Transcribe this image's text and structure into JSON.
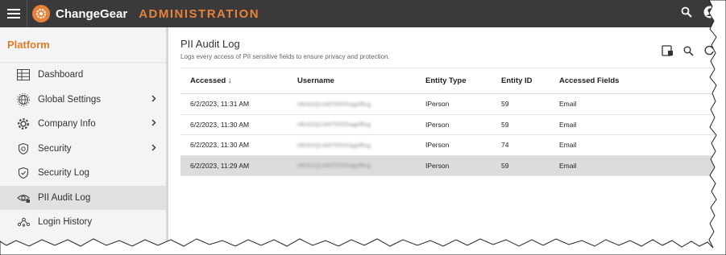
{
  "header": {
    "app_name": "ChangeGear",
    "section": "ADMINISTRATION",
    "colors": {
      "bar": "#3a3a3a",
      "accent": "#e8823a"
    },
    "icons": [
      "menu-icon",
      "gear-logo-icon",
      "search-icon",
      "user-account-icon"
    ]
  },
  "sidebar": {
    "title": "Platform",
    "items": [
      {
        "label": "Dashboard",
        "icon": "table-grid-icon",
        "chevron": false,
        "active": false
      },
      {
        "label": "Global Settings",
        "icon": "globe-icon",
        "chevron": true,
        "active": false
      },
      {
        "label": "Company Info",
        "icon": "gear-icon",
        "chevron": true,
        "active": false
      },
      {
        "label": "Security",
        "icon": "shield-icon",
        "chevron": true,
        "active": false
      },
      {
        "label": "Security Log",
        "icon": "shield-check-icon",
        "chevron": false,
        "active": false
      },
      {
        "label": "PII Audit Log",
        "icon": "eye-lock-icon",
        "chevron": false,
        "active": true
      },
      {
        "label": "Login History",
        "icon": "network-icon",
        "chevron": false,
        "active": false
      }
    ]
  },
  "main": {
    "title": "PII Audit Log",
    "subtitle": "Logs every access of PII sensitive fields to ensure privacy and protection.",
    "tools": [
      "column-chooser-icon",
      "search-icon",
      "refresh-icon"
    ],
    "table": {
      "columns": [
        "Accessed ↓",
        "Username",
        "Entity Type",
        "Entity ID",
        "Accessed Fields"
      ],
      "rows": [
        {
          "accessed": "6/2/2023, 11:31 AM",
          "username": "HEADQUARTERS\\ageffing",
          "entity_type": "IPerson",
          "entity_id": "59",
          "fields": "Email",
          "selected": false
        },
        {
          "accessed": "6/2/2023, 11:30 AM",
          "username": "HEADQUARTERS\\ageffing",
          "entity_type": "IPerson",
          "entity_id": "59",
          "fields": "Email",
          "selected": false
        },
        {
          "accessed": "6/2/2023, 11:30 AM",
          "username": "HEADQUARTERS\\ageffing",
          "entity_type": "IPerson",
          "entity_id": "74",
          "fields": "Email",
          "selected": false
        },
        {
          "accessed": "6/2/2023, 11:29 AM",
          "username": "HEADQUARTERS\\ageffing",
          "entity_type": "IPerson",
          "entity_id": "59",
          "fields": "Email",
          "selected": true
        }
      ]
    }
  }
}
